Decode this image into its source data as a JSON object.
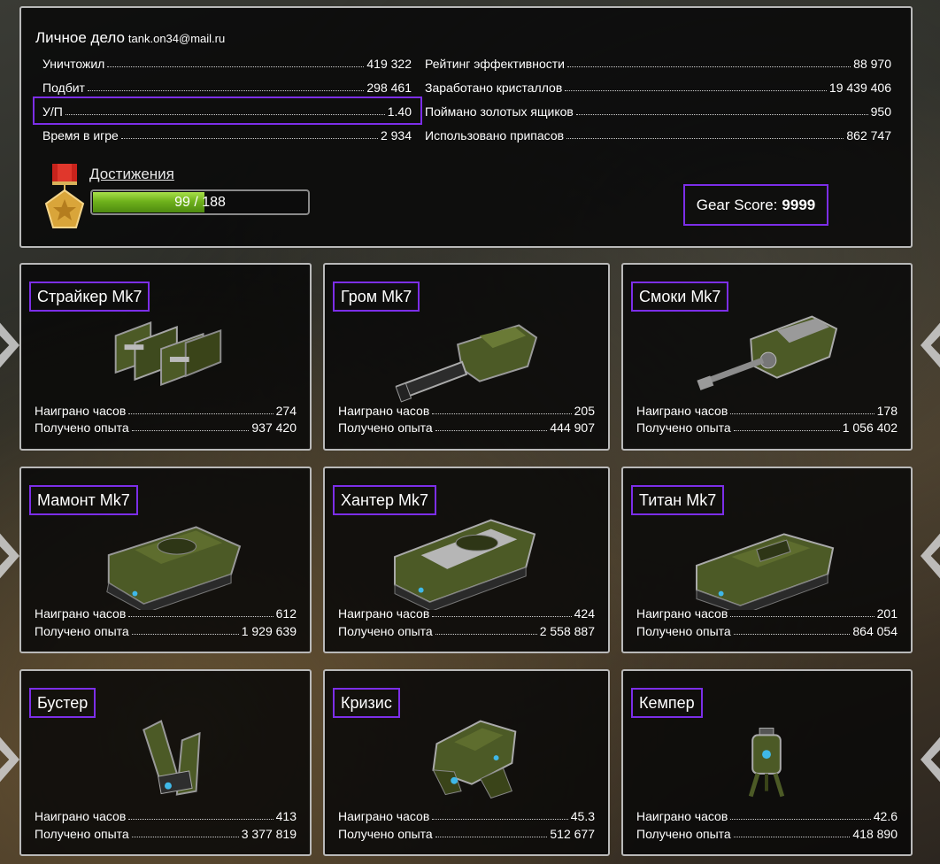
{
  "profile": {
    "title": "Личное дело",
    "email": "tank.on34@mail.ru",
    "left_stats": [
      {
        "label": "Уничтожил",
        "value": "419 322"
      },
      {
        "label": "Подбит",
        "value": "298 461"
      },
      {
        "label": "У/П",
        "value": "1.40"
      },
      {
        "label": "Время в игре",
        "value": "2 934"
      }
    ],
    "right_stats": [
      {
        "label": "Рейтинг эффективности",
        "value": "88 970"
      },
      {
        "label": "Заработано кристаллов",
        "value": "19 439 406"
      },
      {
        "label": "Поймано золотых ящиков",
        "value": "950"
      },
      {
        "label": "Использовано припасов",
        "value": "862 747"
      }
    ],
    "achievements": {
      "label": "Достижения",
      "progress_text": "99 / 188",
      "progress_fraction": 0.5266
    },
    "gear_score": {
      "label": "Gear Score:",
      "value": "9999"
    }
  },
  "labels": {
    "hours": "Наиграно часов",
    "xp": "Получено опыта"
  },
  "colors": {
    "highlight": "#7c2ee8",
    "tank_green": "#4c5a26",
    "progress_green": "#6fb21c"
  },
  "cards": [
    {
      "name": "Страйкер Mk7",
      "icon": "striker-turret-icon",
      "hours": "274",
      "xp": "937 420"
    },
    {
      "name": "Гром Mk7",
      "icon": "thunder-turret-icon",
      "hours": "205",
      "xp": "444 907"
    },
    {
      "name": "Смоки Mk7",
      "icon": "smoky-turret-icon",
      "hours": "178",
      "xp": "1 056 402"
    },
    {
      "name": "Мамонт Mk7",
      "icon": "mammoth-hull-icon",
      "hours": "612",
      "xp": "1 929 639"
    },
    {
      "name": "Хантер Mk7",
      "icon": "hunter-hull-icon",
      "hours": "424",
      "xp": "2 558 887"
    },
    {
      "name": "Титан Mk7",
      "icon": "titan-hull-icon",
      "hours": "201",
      "xp": "864 054"
    },
    {
      "name": "Бустер",
      "icon": "booster-drone-icon",
      "hours": "413",
      "xp": "3 377 819"
    },
    {
      "name": "Кризис",
      "icon": "crisis-drone-icon",
      "hours": "45.3",
      "xp": "512 677"
    },
    {
      "name": "Кемпер",
      "icon": "camper-drone-icon",
      "hours": "42.6",
      "xp": "418 890"
    }
  ]
}
